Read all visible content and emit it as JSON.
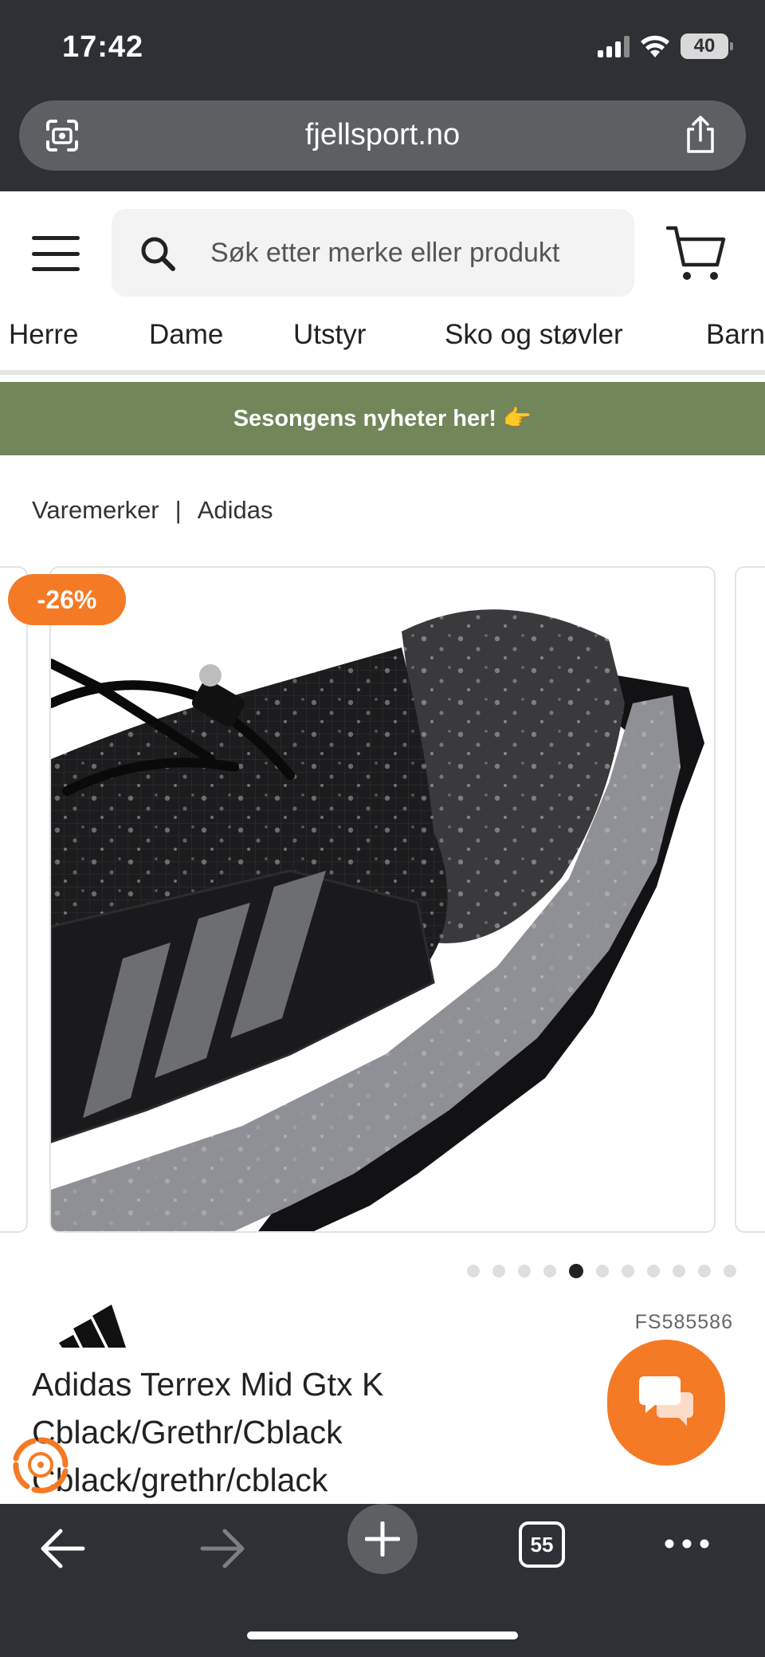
{
  "status_bar": {
    "time": "17:42",
    "battery": "40"
  },
  "browser": {
    "url": "fjellsport.no",
    "tabs_count": "55"
  },
  "header": {
    "search_placeholder": "Søk etter merke eller produkt",
    "nav": [
      "Herre",
      "Dame",
      "Utstyr",
      "Sko og støvler",
      "Barn"
    ]
  },
  "promo": {
    "text": "Sesongens nyheter her! 👉"
  },
  "breadcrumb": {
    "items": [
      "Varemerker",
      "Adidas"
    ],
    "separator": "|"
  },
  "gallery": {
    "discount": "-26%",
    "dot_count": 11,
    "active_index": 4
  },
  "product": {
    "sku": "FS585586",
    "title_lines": [
      "Adidas Terrex Mid Gtx K",
      "Cblack/Grethr/Cblack",
      "Cblack/grethr/cblack"
    ]
  },
  "colors": {
    "accent": "#f57a25",
    "promo_bg": "#728659",
    "chrome_bg": "#2d3034"
  },
  "icons": {
    "url_left": "screen-capture-icon",
    "share": "share-icon",
    "search": "search-icon",
    "cart": "cart-icon",
    "menu": "hamburger-menu-icon",
    "chat": "chat-icon",
    "loyalty": "loyalty-icon",
    "back": "back-arrow-icon",
    "forward": "forward-arrow-icon",
    "new_tab": "plus-icon",
    "more": "more-dots-icon"
  }
}
